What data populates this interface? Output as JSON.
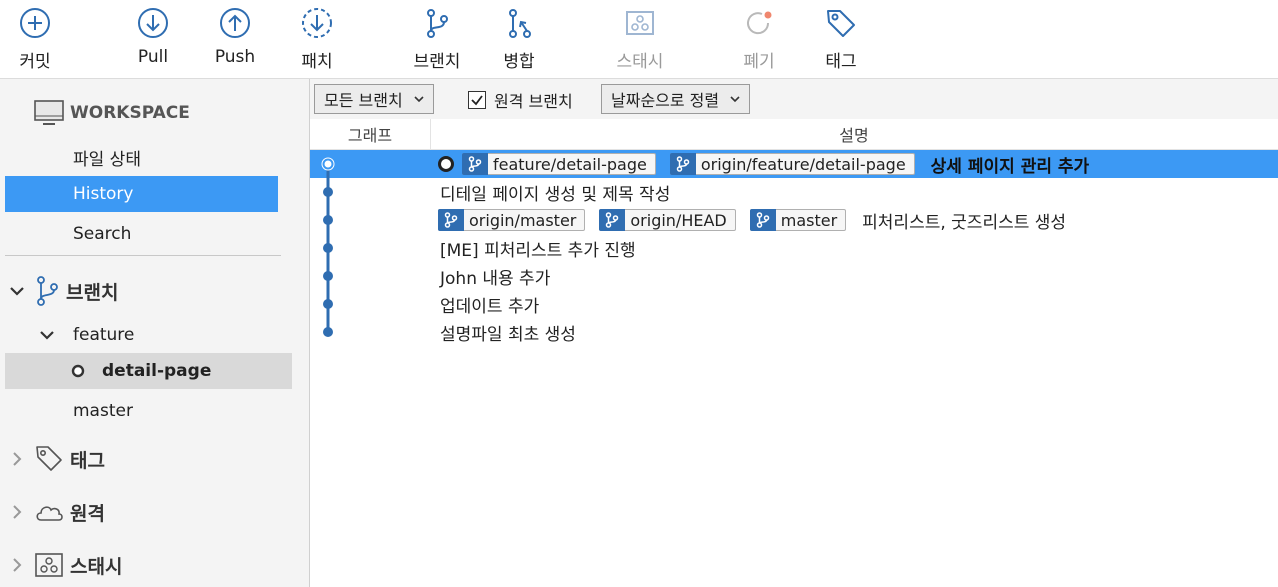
{
  "toolbar": {
    "commit": "커밋",
    "pull": "Pull",
    "push": "Push",
    "patch": "패치",
    "branch": "브랜치",
    "merge": "병합",
    "stash": "스태시",
    "discard": "폐기",
    "tag": "태그"
  },
  "sidebar": {
    "workspace": "WORKSPACE",
    "file_status": "파일 상태",
    "history": "History",
    "search": "Search",
    "branches": "브랜치",
    "feature_folder": "feature",
    "current_branch": "detail-page",
    "master": "master",
    "tags": "태그",
    "remotes": "원격",
    "stashes": "스태시"
  },
  "filter": {
    "all_branches": "모든 브랜치",
    "remote_branches": "원격 브랜치",
    "remote_checked": true,
    "sort": "날짜순으로 정렬"
  },
  "columns": {
    "graph": "그래프",
    "description": "설명"
  },
  "commits": [
    {
      "refs": [
        "feature/detail-page",
        "origin/feature/detail-page"
      ],
      "message": "상세 페이지 관리 추가",
      "head": true
    },
    {
      "refs": [],
      "message": "디테일 페이지 생성 및 제목 작성"
    },
    {
      "refs": [
        "origin/master",
        "origin/HEAD",
        "master"
      ],
      "message": "피처리스트, 굿즈리스트 생성"
    },
    {
      "refs": [],
      "message": "[ME] 피처리스트 추가 진행"
    },
    {
      "refs": [],
      "message": "John 내용 추가"
    },
    {
      "refs": [],
      "message": "업데이트 추가"
    },
    {
      "refs": [],
      "message": "설명파일 최초 생성"
    }
  ],
  "colors": {
    "accent": "#3c99f4",
    "ref_badge": "#2f6db1",
    "graph_line": "#2f6db1"
  }
}
